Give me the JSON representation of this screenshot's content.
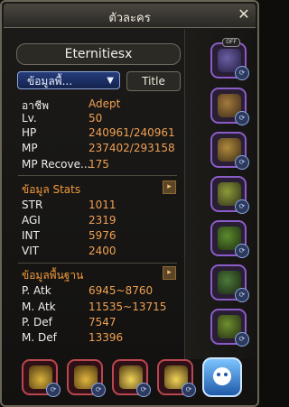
{
  "window": {
    "title": "ตัวละคร",
    "close_glyph": "✕",
    "character_name": "Eternitiesx"
  },
  "tabs": {
    "info_label": "ข้อมูลพื้...",
    "title_label": "Title"
  },
  "stats": {
    "rows": [
      {
        "key": "อาชีพ",
        "value": "Adept"
      },
      {
        "key": "Lv.",
        "value": "50"
      },
      {
        "key": "HP",
        "value": "240961/240961"
      },
      {
        "key": "MP",
        "value": "237402/293158"
      },
      {
        "key": "MP Recove...",
        "value": "175"
      }
    ],
    "section_stats_label": "ข้อมูล Stats",
    "section_stats_rows": [
      {
        "key": "STR",
        "value": "1011"
      },
      {
        "key": "AGI",
        "value": "2319"
      },
      {
        "key": "INT",
        "value": "5976"
      },
      {
        "key": "VIT",
        "value": "2400"
      }
    ],
    "section_basic_label": "ข้อมูลพื้นฐาน",
    "section_basic_rows": [
      {
        "key": "P. Atk",
        "value": "6945~8760"
      },
      {
        "key": "M. Atk",
        "value": "11535~13715"
      },
      {
        "key": "P. Def",
        "value": "7547"
      },
      {
        "key": "M. Def",
        "value": "13396"
      }
    ],
    "off_badge": "OFF"
  },
  "icons": {
    "sync": "⟳",
    "expand": "▸"
  },
  "colors": {
    "value_orange": "#f0a052",
    "section_orange": "#f09a3c",
    "slot_purple": "#8a5cc6",
    "slot_red": "#b9474f"
  }
}
